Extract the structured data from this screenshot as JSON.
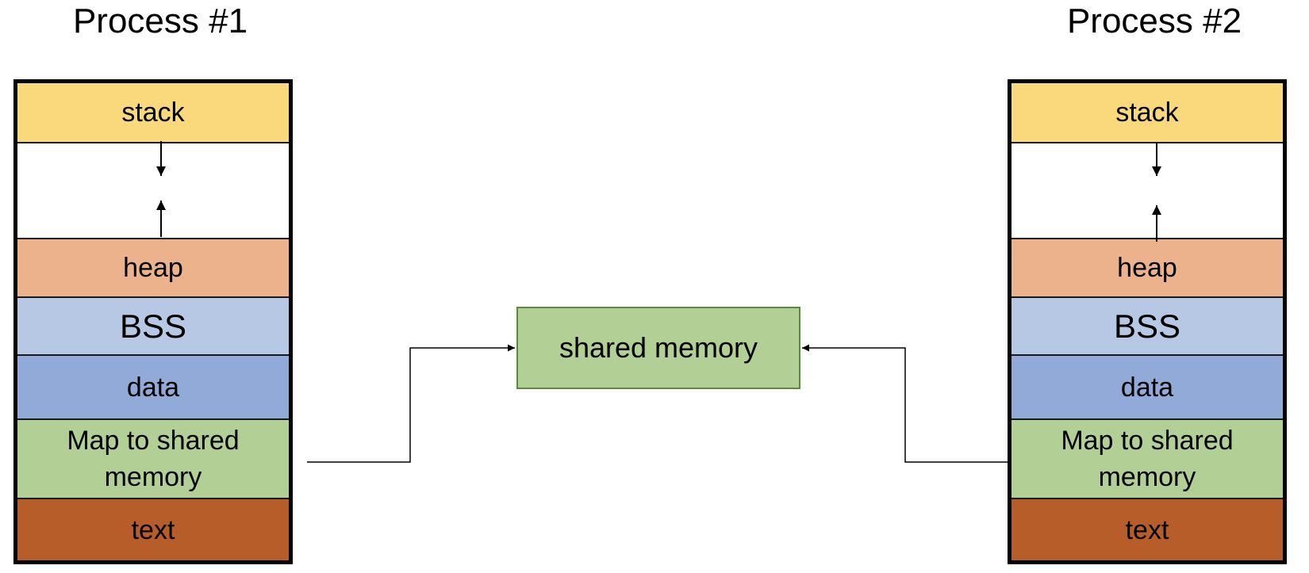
{
  "processes": [
    {
      "title": "Process #1",
      "segments": [
        {
          "label": "stack",
          "color": "#f9d97c"
        },
        {
          "label": "",
          "color": "#ffffff"
        },
        {
          "label": "heap",
          "color": "#ebb28b"
        },
        {
          "label": "BSS",
          "color": "#b7c8e5"
        },
        {
          "label": "data",
          "color": "#92aad8"
        },
        {
          "label": "Map to shared memory",
          "color": "#b2d096"
        },
        {
          "label": "text",
          "color": "#b75d29"
        }
      ]
    },
    {
      "title": "Process #2",
      "segments": [
        {
          "label": "stack",
          "color": "#f9d97c"
        },
        {
          "label": "",
          "color": "#ffffff"
        },
        {
          "label": "heap",
          "color": "#ebb28b"
        },
        {
          "label": "BSS",
          "color": "#b7c8e5"
        },
        {
          "label": "data",
          "color": "#92aad8"
        },
        {
          "label": "Map to shared memory",
          "color": "#b2d096"
        },
        {
          "label": "text",
          "color": "#b75d29"
        }
      ]
    }
  ],
  "shared_memory": {
    "label": "shared memory",
    "color": "#b2d096",
    "border": "#5b8a3a"
  },
  "connections": [
    {
      "from": "Process #1 / Map to shared memory",
      "to": "shared memory"
    },
    {
      "from": "Process #2 / Map to shared memory",
      "to": "shared memory"
    }
  ]
}
